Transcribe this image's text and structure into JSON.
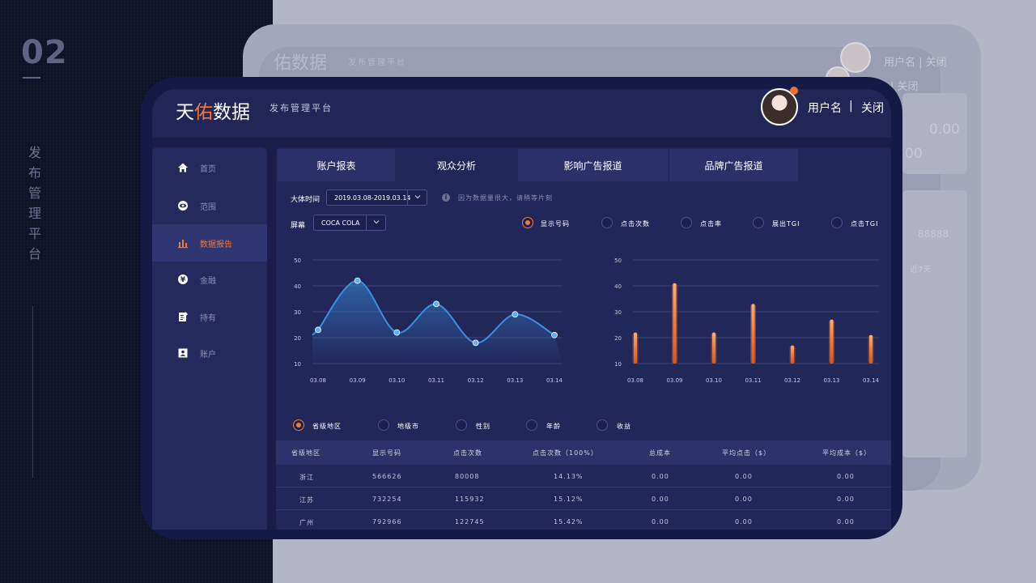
{
  "slide": {
    "section_number": "02",
    "vertical_title": "发布管理平台"
  },
  "ghost": {
    "brand": "佑数据",
    "subtitle": "发布管理平台",
    "user_text_1": "用户名 | 关闭",
    "user_text_2": "| 关闭",
    "value_1": "0.00",
    "value_2": "00",
    "value_3": "88888",
    "value_4": "近7天"
  },
  "header": {
    "brand_prefix": "天",
    "brand_accent": "佑",
    "brand_suffix": "数据",
    "subtitle": "发布管理平台",
    "user_name": "用户名",
    "separator": "|",
    "close": "关闭"
  },
  "sidebar": {
    "items": [
      {
        "label": "首页",
        "icon": "home-icon"
      },
      {
        "label": "范围",
        "icon": "eye-icon"
      },
      {
        "label": "数据报告",
        "icon": "bar-chart-icon",
        "active": true
      },
      {
        "label": "金融",
        "icon": "yen-icon"
      },
      {
        "label": "持有",
        "icon": "clipboard-icon"
      },
      {
        "label": "账户",
        "icon": "user-card-icon"
      }
    ]
  },
  "tabs": [
    {
      "label": "账户报表"
    },
    {
      "label": "观众分析",
      "active": true
    },
    {
      "label": "影响广告报道"
    },
    {
      "label": "品牌广告报道"
    }
  ],
  "filters": {
    "time_label": "大体时间",
    "time_value": "2019.03.08-2019.03.14",
    "info_text": "因为数据量很大，请稍等片刻",
    "screen_label": "屏幕",
    "screen_value": "COCA COLA"
  },
  "metric_options": [
    {
      "label": "显示号码",
      "selected": true
    },
    {
      "label": "点击次数",
      "selected": false
    },
    {
      "label": "点击率",
      "selected": false
    },
    {
      "label": "展出TGI",
      "selected": false
    },
    {
      "label": "点击TGI",
      "selected": false
    }
  ],
  "dimension_options": [
    {
      "label": "省级地区",
      "selected": true
    },
    {
      "label": "地级市",
      "selected": false
    },
    {
      "label": "性别",
      "selected": false
    },
    {
      "label": "年龄",
      "selected": false
    },
    {
      "label": "收益",
      "selected": false
    }
  ],
  "chart_data": [
    {
      "type": "area",
      "categories": [
        "03.08",
        "03.09",
        "03.10",
        "03.11",
        "03.12",
        "03.13",
        "03.14"
      ],
      "values": [
        23,
        42,
        22,
        33,
        18,
        29,
        21
      ],
      "ylim": [
        10,
        50
      ],
      "yticks": [
        "10",
        "20",
        "30",
        "40",
        "50"
      ],
      "grid": true,
      "color": "#3a8fe0"
    },
    {
      "type": "bar",
      "categories": [
        "03.08",
        "03.09",
        "03.10",
        "03.11",
        "03.12",
        "03.13",
        "03.14"
      ],
      "values": [
        22,
        41,
        22,
        33,
        17,
        27,
        21
      ],
      "ylim": [
        10,
        50
      ],
      "yticks": [
        "10",
        "20",
        "30",
        "40",
        "50"
      ],
      "grid": true,
      "color": "#f27a38"
    }
  ],
  "table": {
    "headers": [
      "省级地区",
      "显示号码",
      "点击次数",
      "点击次数（100%）",
      "总成本",
      "平均点击（$）",
      "平均成本（$）"
    ],
    "rows": [
      [
        "浙江",
        "566626",
        "80008",
        "14.13%",
        "0.00",
        "0.00",
        "0.00"
      ],
      [
        "江苏",
        "732254",
        "115932",
        "15.12%",
        "0.00",
        "0.00",
        "0.00"
      ],
      [
        "广州",
        "792966",
        "122745",
        "15.42%",
        "0.00",
        "0.00",
        "0.00"
      ]
    ]
  }
}
